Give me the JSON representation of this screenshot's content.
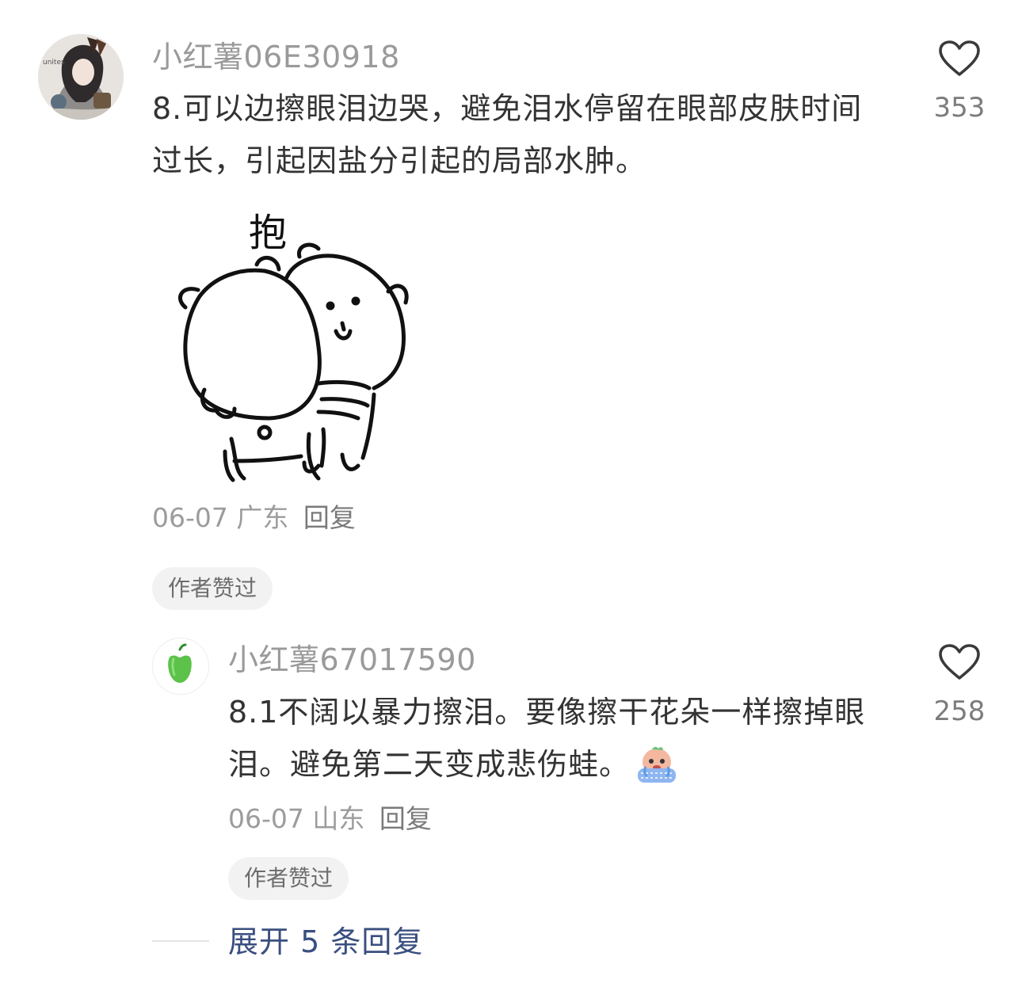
{
  "comment": {
    "username": "小红薯06E30918",
    "text": "8.可以边擦眼泪边哭，避免泪水停留在眼部皮肤时间过长，引起因盐分引起的局部水肿。",
    "sticker_text": "抱",
    "date": "06-07",
    "location": "广东",
    "reply_label": "回复",
    "like_count": "353",
    "author_liked_tag": "作者赞过",
    "avatar_text": "unites"
  },
  "reply": {
    "username": "小红薯67017590",
    "text": "8.1不阔以暴力擦泪。要像擦干花朵一样擦掉眼泪。避免第二天变成悲伤蛙。",
    "date": "06-07",
    "location": "山东",
    "reply_label": "回复",
    "like_count": "258",
    "author_liked_tag": "作者赞过",
    "emoji_icon": "crying-face-emoji",
    "avatar_icon": "green-pepper-icon"
  },
  "expand_replies_label": "展开 5 条回复",
  "colors": {
    "text_primary": "#333333",
    "text_secondary": "#9a9a9a",
    "link": "#3a4f80",
    "tag_bg": "#f2f2f2",
    "avatar_pepper": "#5cc24a"
  }
}
